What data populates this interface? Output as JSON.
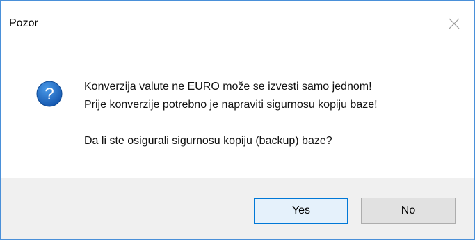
{
  "dialog": {
    "title": "Pozor",
    "close_icon": "close-icon",
    "message_icon": "question-icon",
    "message": {
      "line1": "Konverzija valute ne EURO može se izvesti samo jednom!",
      "line2": "Prije konverzije potrebno je napraviti sigurnosu kopiju baze!",
      "line3": "Da li ste osigurali sigurnosu kopiju (backup) baze?"
    },
    "buttons": {
      "yes_label": "Yes",
      "no_label": "No"
    }
  },
  "colors": {
    "border": "#4a90d9",
    "icon_blue": "#1e6fc9",
    "footer_bg": "#f0f0f0",
    "default_button_border": "#0078d7"
  }
}
